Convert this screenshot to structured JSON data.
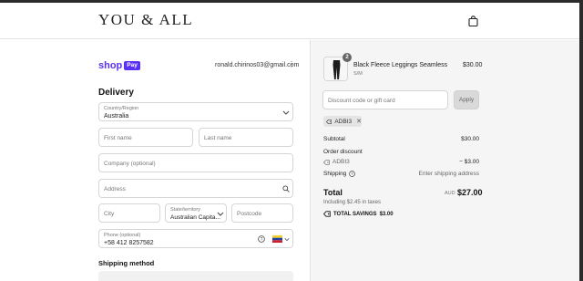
{
  "header": {
    "logo": "YOU & ALL"
  },
  "express": {
    "brand_shop": "shop",
    "brand_pay": "Pay",
    "email": "ronald.chirinos03@gmail.com"
  },
  "delivery": {
    "title": "Delivery",
    "country_label": "Country/Region",
    "country_value": "Australia",
    "first_name_placeholder": "First name",
    "last_name_placeholder": "Last name",
    "company_placeholder": "Company (optional)",
    "address_placeholder": "Address",
    "city_placeholder": "City",
    "state_label": "State/territory",
    "state_value": "Australian Capita...",
    "postcode_placeholder": "Postcode",
    "phone_label": "Phone (optional)",
    "phone_value": "+58 412 8257582"
  },
  "shipping_method": {
    "title": "Shipping method"
  },
  "summary": {
    "product": {
      "qty": "2",
      "name": "Black Fleece Leggings Seamless",
      "variant": "S/M",
      "price": "$30.00"
    },
    "discount_placeholder": "Discount code or gift card",
    "apply_label": "Apply",
    "applied_code": "ADBI3",
    "subtotal_label": "Subtotal",
    "subtotal_value": "$30.00",
    "order_discount_label": "Order discount",
    "discount_code": "ADBI3",
    "discount_value": "− $3.00",
    "shipping_label": "Shipping",
    "shipping_value": "Enter shipping address",
    "total_label": "Total",
    "total_currency": "AUD",
    "total_value": "$27.00",
    "taxes_note": "Including $2.45 in taxes",
    "total_savings_label": "TOTAL SAVINGS",
    "total_savings_value": "$3.00"
  },
  "colors": {
    "shop_pay": "#5a31f4",
    "venezuela_flag": [
      "#f4d02b",
      "#1f3f9c",
      "#cf2030"
    ]
  },
  "icons": [
    "shopping-bag-icon",
    "search-icon",
    "help-circle-icon",
    "tag-icon",
    "chevron-down-icon",
    "kebab-icon"
  ]
}
